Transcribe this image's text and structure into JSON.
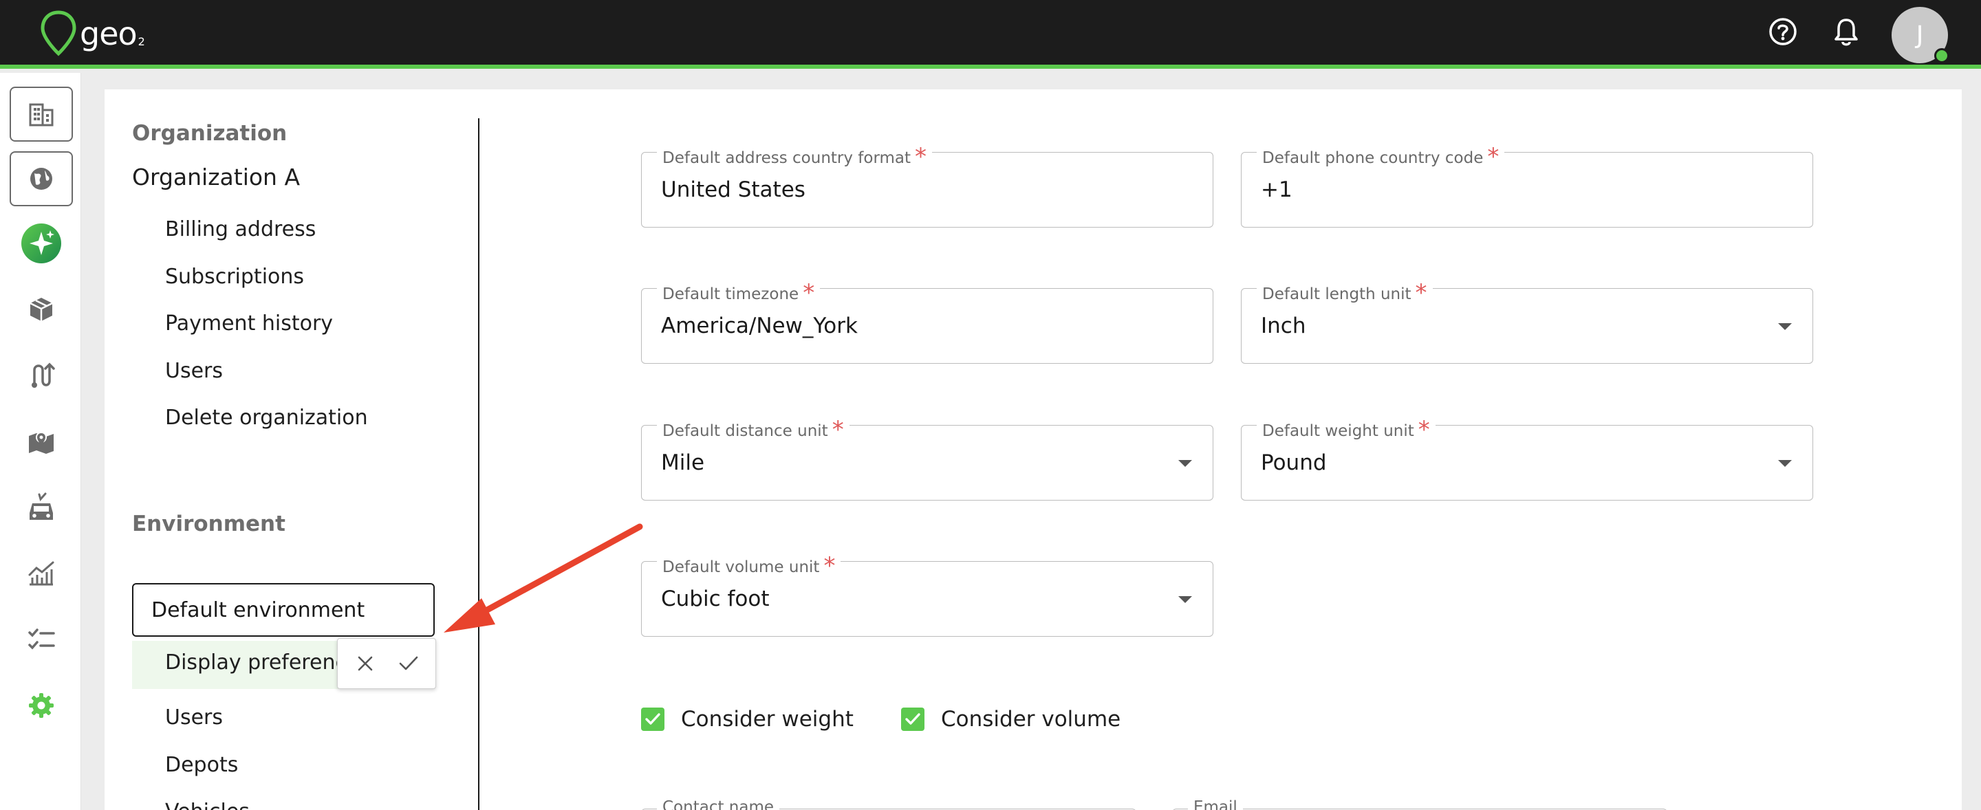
{
  "header": {
    "logo_text": "geo",
    "logo_sub": "2",
    "avatar_initial": "J",
    "icons": [
      "help-icon",
      "bell-icon"
    ]
  },
  "rail": {
    "items": [
      "building-icon",
      "globe-icon",
      "sparkle-icon",
      "package-icon",
      "route-icon",
      "map-icon",
      "vehicle-icon",
      "analytics-icon",
      "checklist-icon",
      "settings-icon"
    ]
  },
  "sidebar": {
    "org_heading": "Organization",
    "org_name": "Organization A",
    "org_items": [
      "Billing address",
      "Subscriptions",
      "Payment history",
      "Users",
      "Delete organization"
    ],
    "env_heading": "Environment",
    "env_name_value": "Default environment",
    "selected_item": "Display preferences",
    "env_items": [
      "Users",
      "Depots",
      "Vehicles"
    ]
  },
  "form": {
    "address_country": {
      "label": "Default address country format",
      "value": "United States"
    },
    "phone_code": {
      "label": "Default phone country code",
      "value": "+1"
    },
    "timezone": {
      "label": "Default timezone",
      "value": "America/New_York"
    },
    "length_unit": {
      "label": "Default length unit",
      "value": "Inch"
    },
    "distance_unit": {
      "label": "Default distance unit",
      "value": "Mile"
    },
    "weight_unit": {
      "label": "Default weight unit",
      "value": "Pound"
    },
    "volume_unit": {
      "label": "Default volume unit",
      "value": "Cubic foot"
    },
    "consider_weight": {
      "label": "Consider weight",
      "checked": true
    },
    "consider_volume": {
      "label": "Consider volume",
      "checked": true
    },
    "contact_name": {
      "label": "Contact name"
    },
    "email": {
      "label": "Email"
    }
  },
  "colors": {
    "accent": "#5cc94e",
    "topbar": "#1c1c1c",
    "required": "#e05a5a",
    "annotation_arrow": "#e8432d"
  }
}
